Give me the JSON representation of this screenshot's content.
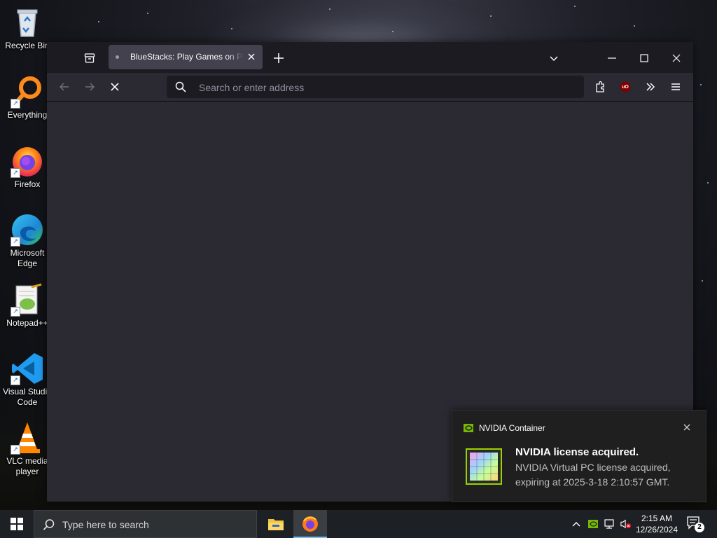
{
  "desktop": {
    "icons": [
      {
        "label": "Recycle Bin"
      },
      {
        "label": "Everything"
      },
      {
        "label": "Firefox"
      },
      {
        "label": "Microsoft Edge"
      },
      {
        "label": "Notepad++"
      },
      {
        "label": "Visual Studio Code"
      },
      {
        "label": "VLC media player"
      }
    ]
  },
  "browser": {
    "tab": {
      "title": "BlueStacks: Play Games on PC & Mac"
    },
    "address_bar": {
      "placeholder": "Search or enter address",
      "value": ""
    },
    "extension_badge": "uO"
  },
  "notification": {
    "app_name": "NVIDIA Container",
    "title": "NVIDIA license acquired.",
    "body": "NVIDIA Virtual PC license acquired, expiring at 2025-3-18 2:10:57 GMT."
  },
  "taskbar": {
    "search_placeholder": "Type here to search",
    "time": "2:15 AM",
    "date": "12/26/2024",
    "notification_count": "2"
  },
  "colors": {
    "browser_frame": "#1c1b22",
    "browser_toolbar": "#2b2a33",
    "tab_active": "#42414d",
    "taskbar": "#1d2024",
    "nvidia_green": "#76b900",
    "accent": "#76b9ed"
  }
}
